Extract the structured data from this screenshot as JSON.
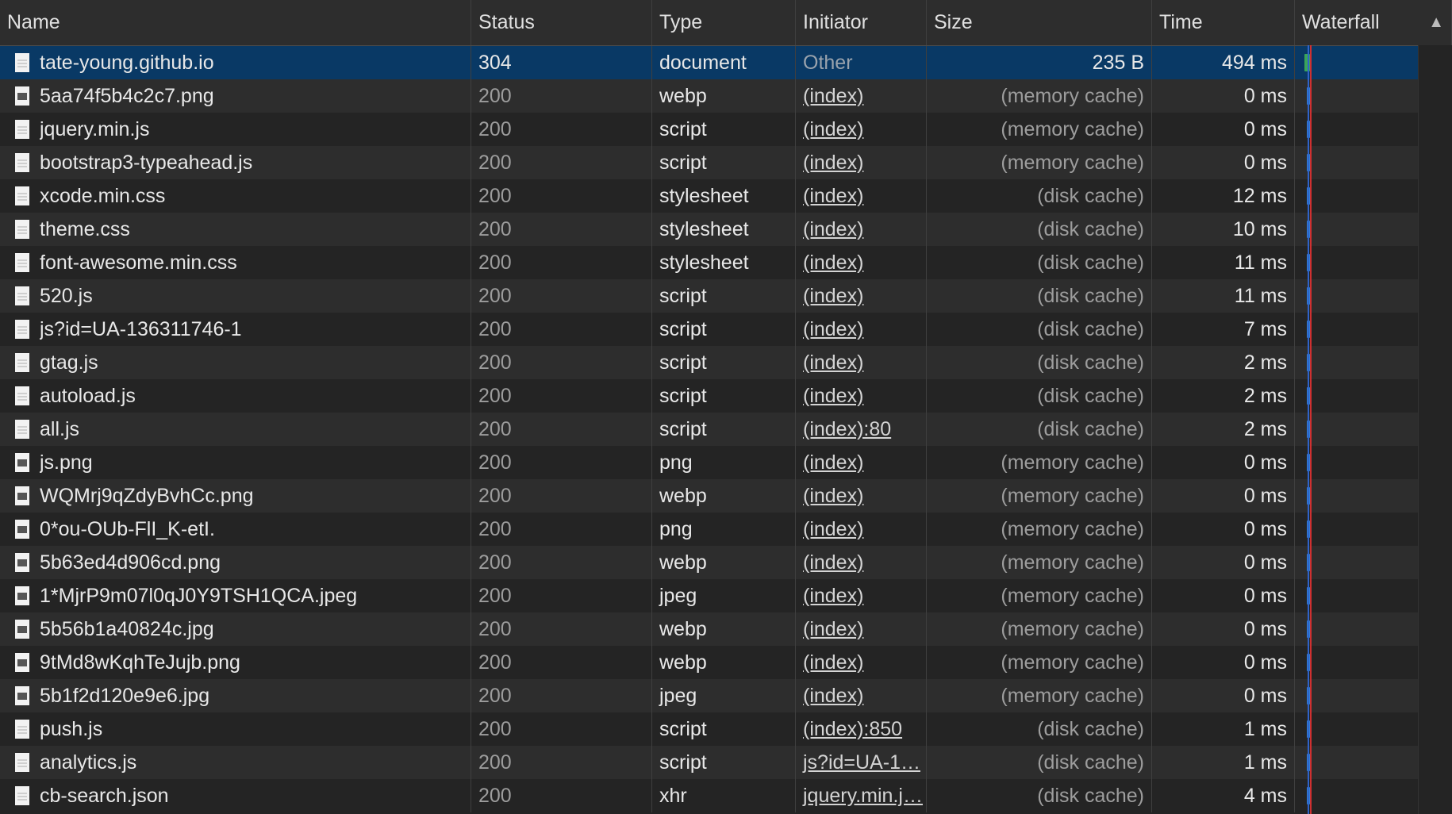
{
  "columns": {
    "name": "Name",
    "status": "Status",
    "type": "Type",
    "initiator": "Initiator",
    "size": "Size",
    "time": "Time",
    "waterfall": "Waterfall",
    "sort_icon": "▲"
  },
  "rows": [
    {
      "name": "tate-young.github.io",
      "status": "304",
      "type": "document",
      "initiator": "Other",
      "size": "235 B",
      "time": "494 ms",
      "icon": "document-icon",
      "selected": true
    },
    {
      "name": "5aa74f5b4c2c7.png",
      "status": "200",
      "type": "webp",
      "initiator": "(index)",
      "size": "(memory cache)",
      "time": "0 ms",
      "icon": "image-icon"
    },
    {
      "name": "jquery.min.js",
      "status": "200",
      "type": "script",
      "initiator": "(index)",
      "size": "(memory cache)",
      "time": "0 ms",
      "icon": "script-file-icon"
    },
    {
      "name": "bootstrap3-typeahead.js",
      "status": "200",
      "type": "script",
      "initiator": "(index)",
      "size": "(memory cache)",
      "time": "0 ms",
      "icon": "script-file-icon"
    },
    {
      "name": "xcode.min.css",
      "status": "200",
      "type": "stylesheet",
      "initiator": "(index)",
      "size": "(disk cache)",
      "time": "12 ms",
      "icon": "stylesheet-file-icon"
    },
    {
      "name": "theme.css",
      "status": "200",
      "type": "stylesheet",
      "initiator": "(index)",
      "size": "(disk cache)",
      "time": "10 ms",
      "icon": "stylesheet-file-icon"
    },
    {
      "name": "font-awesome.min.css",
      "status": "200",
      "type": "stylesheet",
      "initiator": "(index)",
      "size": "(disk cache)",
      "time": "11 ms",
      "icon": "stylesheet-file-icon"
    },
    {
      "name": "520.js",
      "status": "200",
      "type": "script",
      "initiator": "(index)",
      "size": "(disk cache)",
      "time": "11 ms",
      "icon": "script-file-icon"
    },
    {
      "name": "js?id=UA-136311746-1",
      "status": "200",
      "type": "script",
      "initiator": "(index)",
      "size": "(disk cache)",
      "time": "7 ms",
      "icon": "script-file-icon"
    },
    {
      "name": "gtag.js",
      "status": "200",
      "type": "script",
      "initiator": "(index)",
      "size": "(disk cache)",
      "time": "2 ms",
      "icon": "script-file-icon"
    },
    {
      "name": "autoload.js",
      "status": "200",
      "type": "script",
      "initiator": "(index)",
      "size": "(disk cache)",
      "time": "2 ms",
      "icon": "script-file-icon"
    },
    {
      "name": "all.js",
      "status": "200",
      "type": "script",
      "initiator": "(index):80",
      "size": "(disk cache)",
      "time": "2 ms",
      "icon": "script-file-icon"
    },
    {
      "name": "js.png",
      "status": "200",
      "type": "png",
      "initiator": "(index)",
      "size": "(memory cache)",
      "time": "0 ms",
      "icon": "image-icon"
    },
    {
      "name": "WQMrj9qZdyBvhCc.png",
      "status": "200",
      "type": "webp",
      "initiator": "(index)",
      "size": "(memory cache)",
      "time": "0 ms",
      "icon": "image-icon"
    },
    {
      "name": "0*ou-OUb-FlI_K-etI.",
      "status": "200",
      "type": "png",
      "initiator": "(index)",
      "size": "(memory cache)",
      "time": "0 ms",
      "icon": "image-icon"
    },
    {
      "name": "5b63ed4d906cd.png",
      "status": "200",
      "type": "webp",
      "initiator": "(index)",
      "size": "(memory cache)",
      "time": "0 ms",
      "icon": "image-icon"
    },
    {
      "name": "1*MjrP9m07l0qJ0Y9TSH1QCA.jpeg",
      "status": "200",
      "type": "jpeg",
      "initiator": "(index)",
      "size": "(memory cache)",
      "time": "0 ms",
      "icon": "image-icon"
    },
    {
      "name": "5b56b1a40824c.jpg",
      "status": "200",
      "type": "webp",
      "initiator": "(index)",
      "size": "(memory cache)",
      "time": "0 ms",
      "icon": "image-icon"
    },
    {
      "name": "9tMd8wKqhTeJujb.png",
      "status": "200",
      "type": "webp",
      "initiator": "(index)",
      "size": "(memory cache)",
      "time": "0 ms",
      "icon": "image-icon"
    },
    {
      "name": "5b1f2d120e9e6.jpg",
      "status": "200",
      "type": "jpeg",
      "initiator": "(index)",
      "size": "(memory cache)",
      "time": "0 ms",
      "icon": "image-icon"
    },
    {
      "name": "push.js",
      "status": "200",
      "type": "script",
      "initiator": "(index):850",
      "size": "(disk cache)",
      "time": "1 ms",
      "icon": "script-file-icon"
    },
    {
      "name": "analytics.js",
      "status": "200",
      "type": "script",
      "initiator": "js?id=UA-1…",
      "size": "(disk cache)",
      "time": "1 ms",
      "icon": "script-file-icon"
    },
    {
      "name": "cb-search.json",
      "status": "200",
      "type": "xhr",
      "initiator": "jquery.min.j…",
      "size": "(disk cache)",
      "time": "4 ms",
      "icon": "json-file-icon"
    }
  ],
  "colors": {
    "selected_row": "#093965",
    "row_odd": "#2d2d2d",
    "row_even": "#242424",
    "waterfall_bar": "#2f7fd6",
    "waterfall_doc_bar": "#3aa55a",
    "load_line": "#d03030"
  }
}
